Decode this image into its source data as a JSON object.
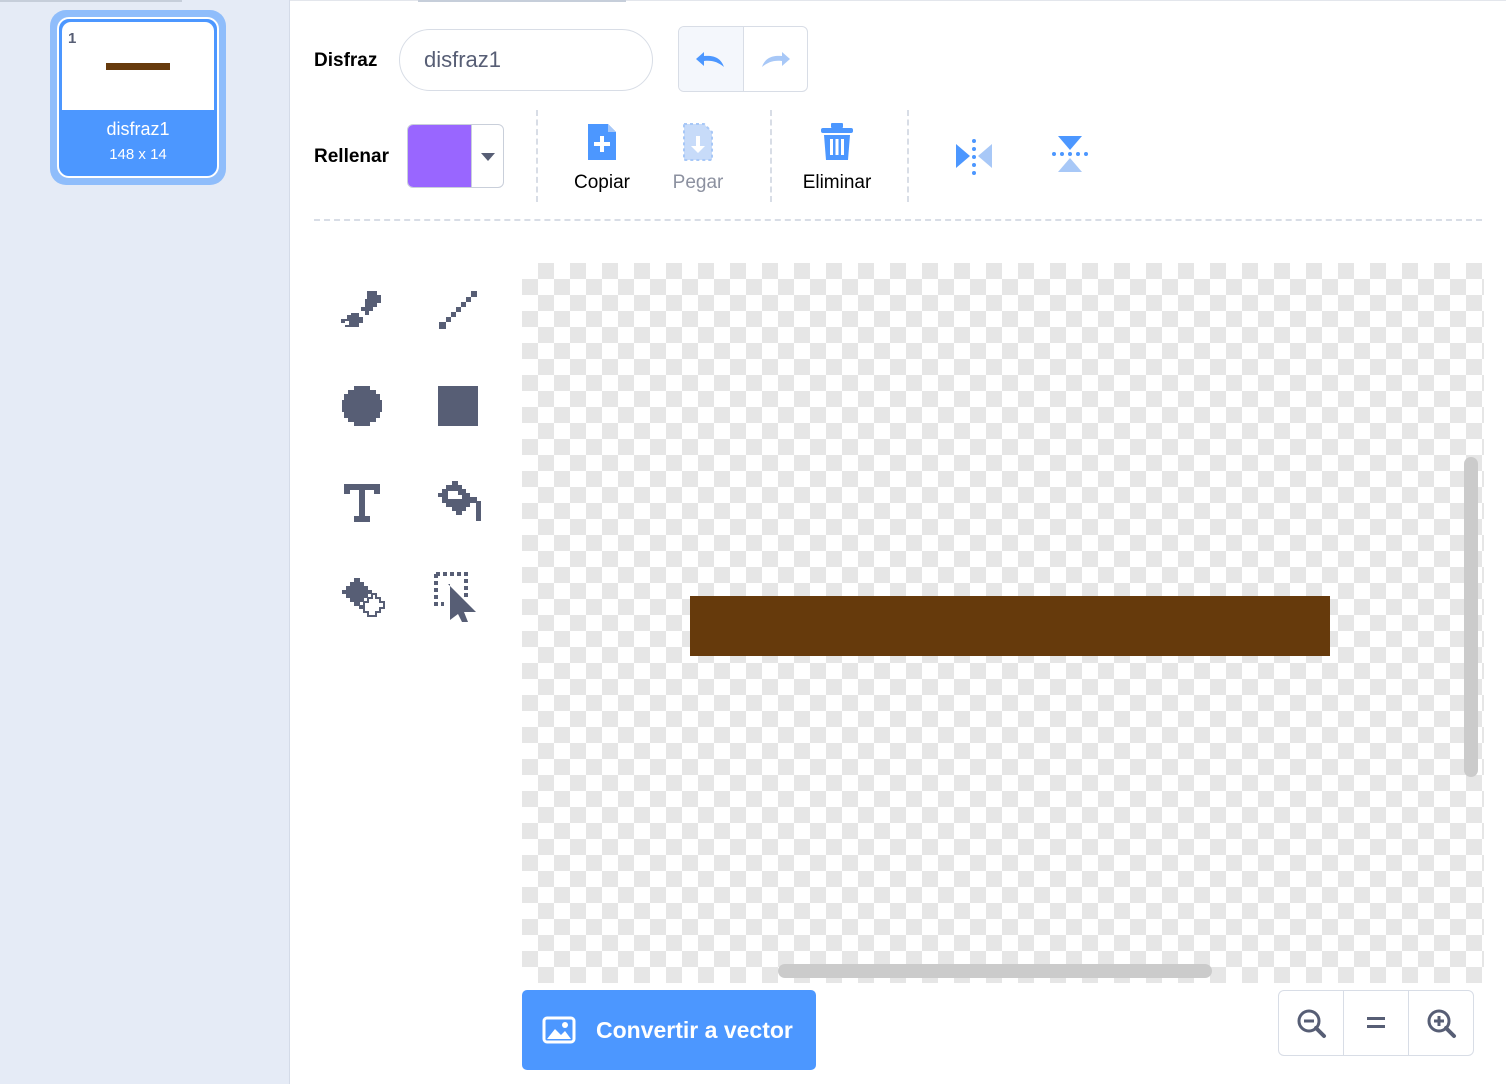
{
  "costume_list": {
    "items": [
      {
        "number": "1",
        "name": "disfraz1",
        "size": "148 x 14"
      }
    ]
  },
  "toolbar": {
    "costume_label": "Disfraz",
    "costume_name_value": "disfraz1",
    "fill_label": "Rellenar",
    "fill_color": "#9966ff",
    "copy_label": "Copiar",
    "paste_label": "Pegar",
    "delete_label": "Eliminar"
  },
  "canvas": {
    "shape_color": "#663a0c"
  },
  "footer": {
    "convert_label": "Convertir a vector"
  },
  "colors": {
    "accent": "#4c97ff",
    "icon_dark": "#575e75"
  }
}
